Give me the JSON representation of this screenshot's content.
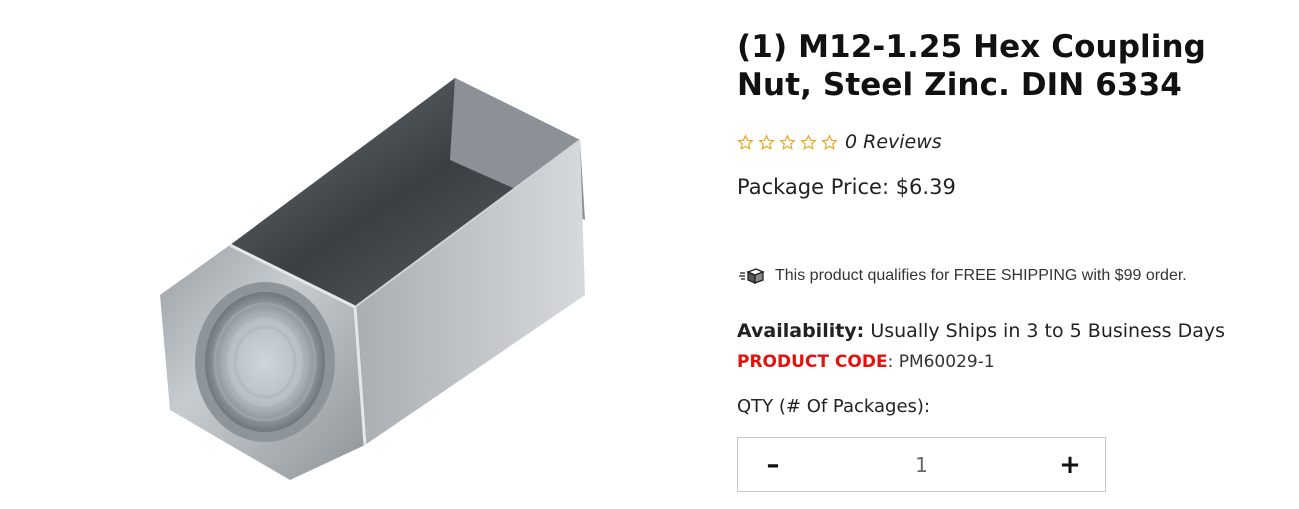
{
  "product": {
    "title": "(1) M12-1.25 Hex Coupling Nut, Steel Zinc. DIN 6334",
    "image_icon": "hex-coupling-nut-photo"
  },
  "rating": {
    "stars": 0,
    "max_stars": 5,
    "reviews_text": "0 Reviews",
    "star_color": "#e8a317"
  },
  "price": {
    "text": "Package Price: $6.39"
  },
  "shipping": {
    "icon": "truck-icon",
    "text": "This product qualifies for FREE SHIPPING with $99 order."
  },
  "availability": {
    "label": "Availability:",
    "value": " Usually Ships in 3 to 5 Business Days"
  },
  "product_code": {
    "label": "PRODUCT CODE",
    "separator": ":",
    "value": " PM60029-1",
    "label_color": "#e3120b"
  },
  "quantity": {
    "label": "QTY (# Of Packages):",
    "value": "1",
    "decrement_label": "–",
    "increment_label": "+"
  }
}
